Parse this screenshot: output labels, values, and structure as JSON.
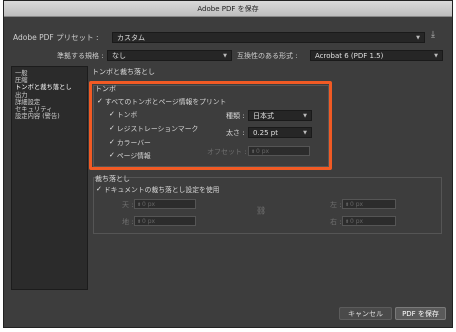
{
  "window": {
    "title": "Adobe PDF を保存"
  },
  "preset": {
    "label": "Adobe PDF プリセット :",
    "value": "カスタム"
  },
  "standard": {
    "label": "準拠する規格 :",
    "value": "なし"
  },
  "compat": {
    "label": "互換性のある形式 :",
    "value": "Acrobat 6 (PDF 1.5)"
  },
  "sidebar": {
    "items": [
      {
        "label": "一般"
      },
      {
        "label": "圧縮"
      },
      {
        "label": "トンボと裁ち落とし"
      },
      {
        "label": "出力"
      },
      {
        "label": "詳細設定"
      },
      {
        "label": "セキュリティ"
      },
      {
        "label": "設定内容 (警告)"
      }
    ]
  },
  "main": {
    "heading": "トンボと裁ち落とし",
    "marks": {
      "title": "トンボ",
      "all_marks": "すべてのトンボとページ情報をプリント",
      "trim": "トンボ",
      "registration": "レジストレーションマーク",
      "color_bar": "カラーバー",
      "page_info": "ページ情報",
      "type_label": "種類 :",
      "type_value": "日本式",
      "weight_label": "太さ :",
      "weight_value": "0.25 pt",
      "offset_label": "オフセット :",
      "offset_value": "0 px"
    },
    "bleed": {
      "title": "裁ち落とし",
      "use_doc": "ドキュメントの裁ち落とし設定を使用",
      "top_label": "天 :",
      "bottom_label": "地 :",
      "left_label": "左 :",
      "right_label": "右 :",
      "top_value": "0 px",
      "bottom_value": "0 px",
      "left_value": "0 px",
      "right_value": "0 px"
    }
  },
  "buttons": {
    "cancel": "キャンセル",
    "save": "PDF を保存"
  },
  "colors": {
    "highlight": "#f15a24",
    "background": "#3d3d3d"
  }
}
